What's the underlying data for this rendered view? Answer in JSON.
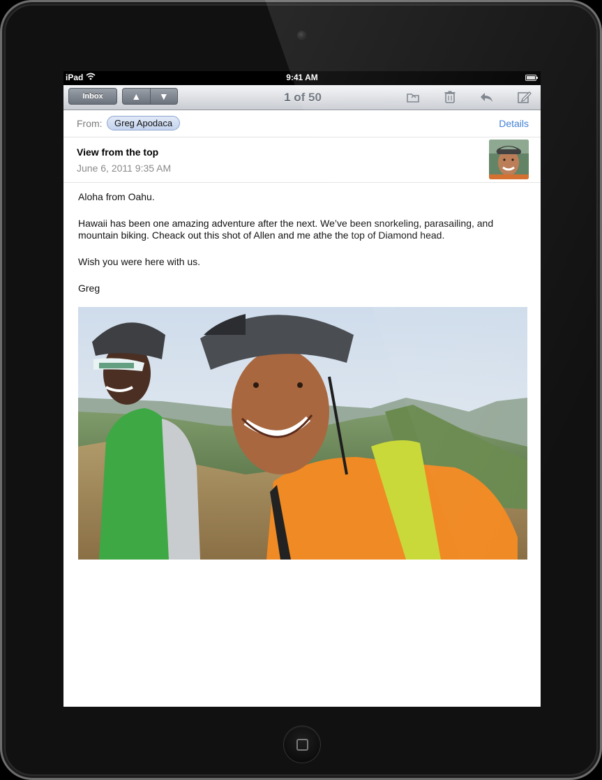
{
  "status_bar": {
    "carrier": "iPad",
    "time": "9:41 AM"
  },
  "toolbar": {
    "inbox_label": "Inbox",
    "counter": "1 of 50",
    "icons": [
      "arrow-up-icon",
      "arrow-down-icon",
      "folder-icon",
      "trash-icon",
      "reply-icon",
      "compose-icon"
    ]
  },
  "message": {
    "from_label": "From:",
    "sender": "Greg Apodaca",
    "details_label": "Details",
    "subject": "View from the top",
    "date": "June 6, 2011 9:35 AM",
    "body": [
      "Aloha from Oahu.",
      "Hawaii has been one amazing adventure after the next. We’ve been snorkeling, parasailing, and mountain biking. Cheack out this shot of Allen and me athe the top of Diamond head.",
      "Wish you were here with us.",
      "Greg"
    ]
  },
  "colors": {
    "link": "#3a7bd5",
    "pill": "#c4d4ee",
    "toolbar_top": "#f4f5f7",
    "toolbar_bottom": "#c9ccd2"
  }
}
